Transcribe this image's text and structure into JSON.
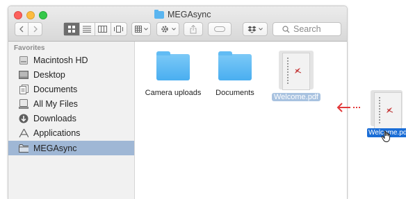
{
  "window": {
    "title": "MEGAsync"
  },
  "toolbar": {
    "search_placeholder": "Search"
  },
  "sidebar": {
    "heading": "Favorites",
    "items": [
      {
        "label": "Macintosh HD",
        "icon": "harddrive-icon"
      },
      {
        "label": "Desktop",
        "icon": "desktop-icon"
      },
      {
        "label": "Documents",
        "icon": "documents-icon"
      },
      {
        "label": "All My Files",
        "icon": "all-files-icon"
      },
      {
        "label": "Downloads",
        "icon": "downloads-icon"
      },
      {
        "label": "Applications",
        "icon": "applications-icon"
      },
      {
        "label": "MEGAsync",
        "icon": "folder-icon",
        "selected": true
      }
    ]
  },
  "files": [
    {
      "name": "Camera uploads",
      "type": "folder"
    },
    {
      "name": "Documents",
      "type": "folder"
    },
    {
      "name": "Welcome.pdf",
      "type": "pdf",
      "selected": true
    }
  ],
  "drag": {
    "file_name": "Welcome.pdf"
  },
  "colors": {
    "folder": "#5ab5f0",
    "selection": "#9fb7d5",
    "drag_label": "#1a6dd6",
    "arrow": "#e2393a"
  }
}
